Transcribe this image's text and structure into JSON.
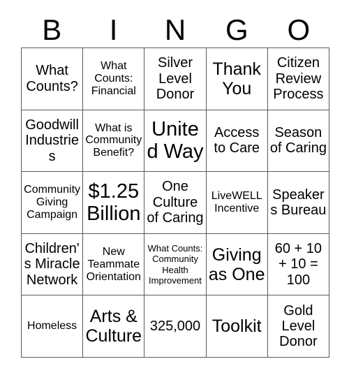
{
  "card": {
    "title": "BINGO",
    "header_letters": [
      "B",
      "I",
      "N",
      "G",
      "O"
    ],
    "columns": [
      "B",
      "I",
      "N",
      "G",
      "O"
    ],
    "rows": 5,
    "cols": 5,
    "grid_line_color": "#5a5a5a",
    "text_color": "#000000",
    "background_color": "#ffffff",
    "cells": [
      [
        {
          "text": "What Counts?",
          "size": "md"
        },
        {
          "text": "What Counts: Financial",
          "size": "sm"
        },
        {
          "text": "Silver Level Donor",
          "size": "md"
        },
        {
          "text": "Thank You",
          "size": "lg"
        },
        {
          "text": "Citizen Review Process",
          "size": "md"
        }
      ],
      [
        {
          "text": "Goodwill Industries",
          "size": "md"
        },
        {
          "text": "What is Community Benefit?",
          "size": "sm"
        },
        {
          "text": "United Way",
          "size": "xl"
        },
        {
          "text": "Access to Care",
          "size": "md"
        },
        {
          "text": "Season of Caring",
          "size": "md"
        }
      ],
      [
        {
          "text": "Community Giving Campaign",
          "size": "sm"
        },
        {
          "text": "$1.25 Billion",
          "size": "xl"
        },
        {
          "text": "One Culture of Caring",
          "size": "md"
        },
        {
          "text": "LiveWELL Incentive",
          "size": "sm"
        },
        {
          "text": "Speakers Bureau",
          "size": "md"
        }
      ],
      [
        {
          "text": "Children's Miracle Network",
          "size": "md"
        },
        {
          "text": "New Teammate Orientation",
          "size": "sm"
        },
        {
          "text": "What Counts: Community Health Improvement",
          "size": "xs"
        },
        {
          "text": "Giving as One",
          "size": "lg"
        },
        {
          "text": "60 + 10 + 10 = 100",
          "size": "md"
        }
      ],
      [
        {
          "text": "Homeless",
          "size": "sm"
        },
        {
          "text": "Arts & Culture",
          "size": "lg"
        },
        {
          "text": "325,000",
          "size": "md"
        },
        {
          "text": "Toolkit",
          "size": "lg"
        },
        {
          "text": "Gold Level Donor",
          "size": "md"
        }
      ]
    ]
  }
}
